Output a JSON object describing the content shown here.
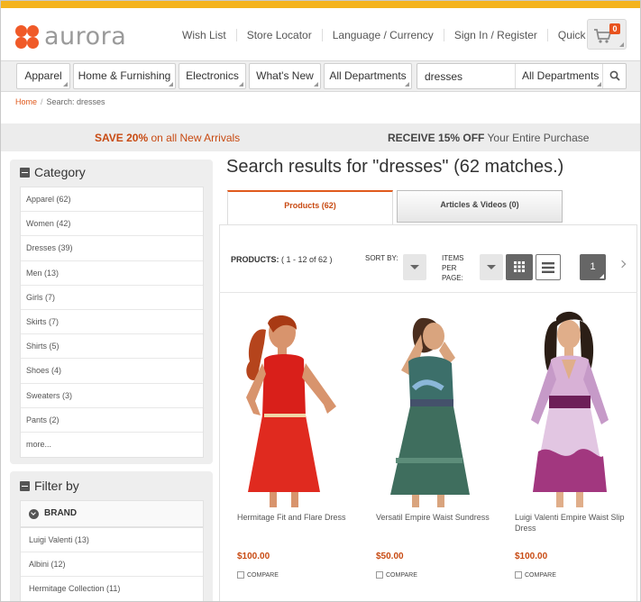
{
  "colors": {
    "accent": "#e05a1d",
    "topbar": "#f4b31d",
    "logo": "#f05a28",
    "price": "#c84a12"
  },
  "header": {
    "logo_text": "aurora",
    "util_nav": [
      "Wish List",
      "Store Locator",
      "Language / Currency",
      "Sign In / Register",
      "Quick Links"
    ],
    "cart_count": "0"
  },
  "departments": [
    "Apparel",
    "Home & Furnishing",
    "Electronics",
    "What's New",
    "All Departments"
  ],
  "search": {
    "value": "dresses",
    "scope": "All Departments"
  },
  "breadcrumb": {
    "home": "Home",
    "current": "Search: dresses"
  },
  "promo": {
    "left_strong": "SAVE 20%",
    "left_rest": " on all New Arrivals",
    "right_strong": "RECEIVE 15% OFF",
    "right_rest": " Your Entire Purchase"
  },
  "sidebar": {
    "category_title": "Category",
    "categories": [
      "Apparel (62)",
      "Women (42)",
      "Dresses (39)",
      "Men (13)",
      "Girls (7)",
      "Skirts (7)",
      "Shirts (5)",
      "Shoes (4)",
      "Sweaters (3)",
      "Pants (2)",
      "more..."
    ],
    "filter_title": "Filter by",
    "brand_title": "BRAND",
    "brands": [
      "Luigi Valenti (13)",
      "Albini (12)",
      "Hermitage Collection (11)"
    ]
  },
  "results": {
    "title": "Search results for \"dresses\" (62 matches.)",
    "tabs": [
      "Products (62)",
      "Articles & Videos (0)"
    ],
    "products_label": "PRODUCTS:",
    "products_range": " ( 1 - 12 of 62 )",
    "sort_label": "SORT BY:",
    "items_per_page_label": [
      "ITEMS",
      "PER",
      "PAGE:"
    ],
    "page": "1",
    "compare_label": "COMPARE",
    "items": [
      {
        "name": "Hermitage Fit and Flare Dress",
        "price": "$100.00"
      },
      {
        "name": "Versatil Empire Waist Sundress",
        "price": "$50.00"
      },
      {
        "name": "Luigi Valenti Empire Waist Slip Dress",
        "price": "$100.00"
      }
    ]
  }
}
